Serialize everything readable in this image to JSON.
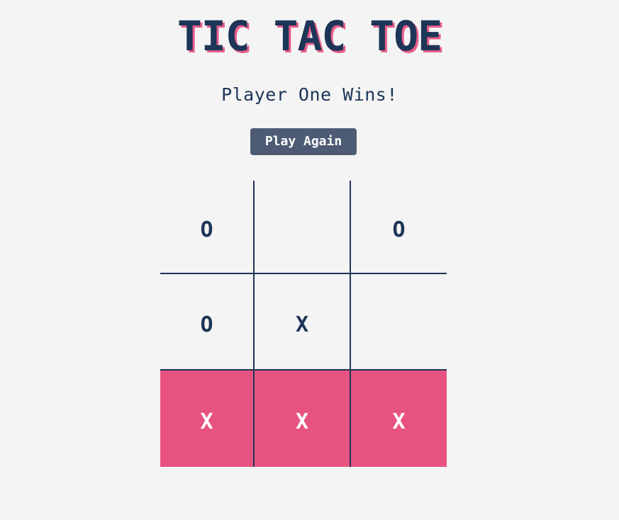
{
  "title": "TIC TAC TOE",
  "status": "Player One Wins!",
  "play_again_label": "Play Again",
  "board": {
    "cells": [
      [
        "O",
        "",
        "O"
      ],
      [
        "O",
        "X",
        ""
      ],
      [
        "X",
        "X",
        "X"
      ]
    ],
    "winning_row": 2
  },
  "colors": {
    "background": "#f4f4f4",
    "primary": "#1d3557",
    "accent": "#e85280",
    "button": "#4d5b74"
  }
}
